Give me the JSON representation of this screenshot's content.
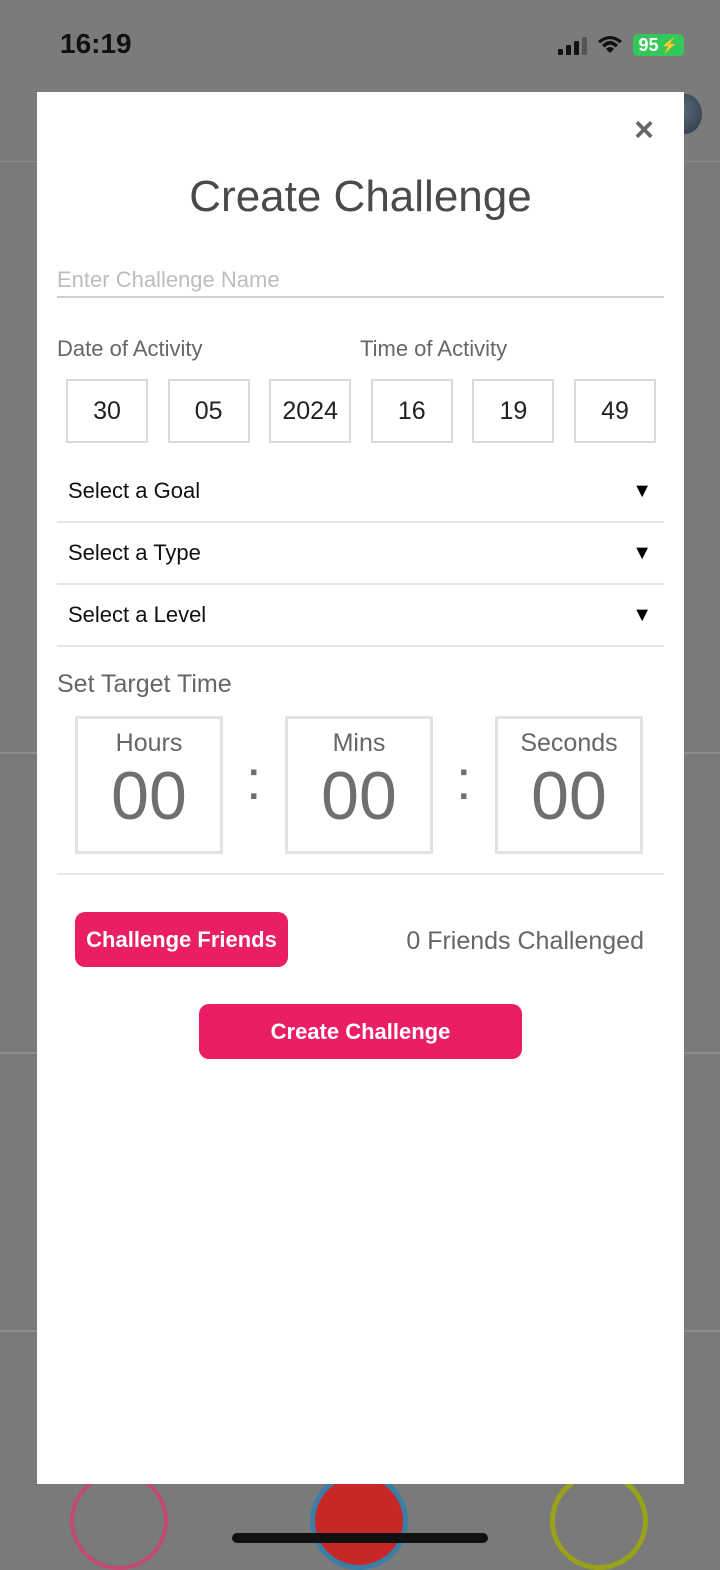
{
  "status_bar": {
    "time": "16:19",
    "battery": "95"
  },
  "modal": {
    "title": "Create Challenge",
    "close_label": "×",
    "name_placeholder": "Enter Challenge Name",
    "date_label": "Date of Activity",
    "time_label": "Time of Activity",
    "date": {
      "day": "30",
      "month": "05",
      "year": "2024"
    },
    "time": {
      "hour": "16",
      "minute": "19",
      "second": "49"
    },
    "selects": {
      "goal": "Select a Goal",
      "type": "Select a Type",
      "level": "Select a Level"
    },
    "dropdown_glyph": "▼",
    "target_time_label": "Set Target Time",
    "target": {
      "hours_label": "Hours",
      "hours": "00",
      "mins_label": "Mins",
      "mins": "00",
      "seconds_label": "Seconds",
      "seconds": "00",
      "separator": ":"
    },
    "challenge_friends_label": "Challenge Friends",
    "friends_challenged": "0 Friends Challenged",
    "create_label": "Create Challenge"
  },
  "colors": {
    "accent": "#e91e63",
    "battery": "#34c759"
  }
}
